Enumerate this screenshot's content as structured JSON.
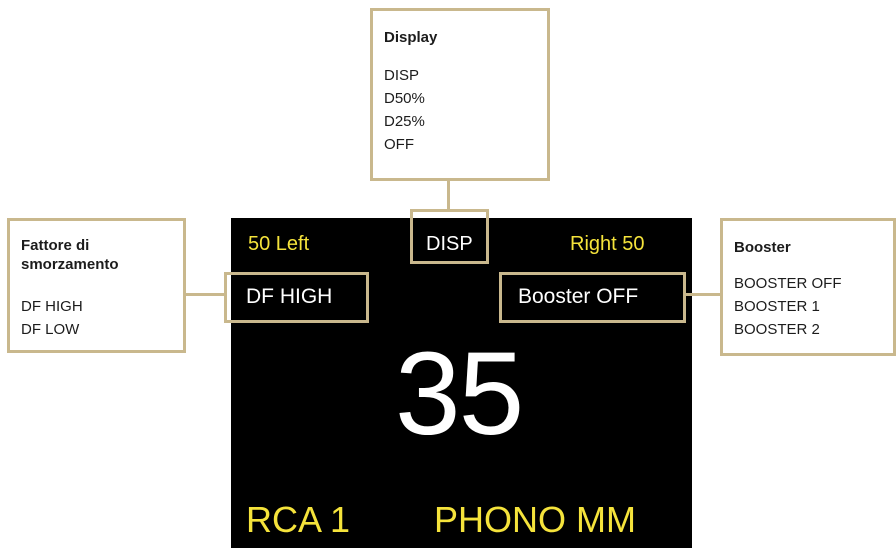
{
  "screen": {
    "balance_left": "50 Left",
    "balance_right": "Right 50",
    "display_mode": "DISP",
    "damping_factor": "DF HIGH",
    "booster": "Booster OFF",
    "volume": "35",
    "input_name": "RCA 1",
    "input_mode": "PHONO MM"
  },
  "callouts": {
    "display": {
      "title": "Display",
      "options": [
        "DISP",
        "D50%",
        "D25%",
        "OFF"
      ]
    },
    "damping_factor": {
      "title": "Fattore di smorzamento",
      "options": [
        "DF HIGH",
        "DF LOW"
      ]
    },
    "booster": {
      "title": "Booster",
      "options": [
        "BOOSTER OFF",
        "BOOSTER 1",
        "BOOSTER 2"
      ]
    }
  },
  "colors": {
    "screen_bg": "#000000",
    "accent_yellow": "#f5e33b",
    "frame_gold": "#c9b88d",
    "text_white": "#ffffff",
    "text_dark": "#1c1c1c"
  }
}
